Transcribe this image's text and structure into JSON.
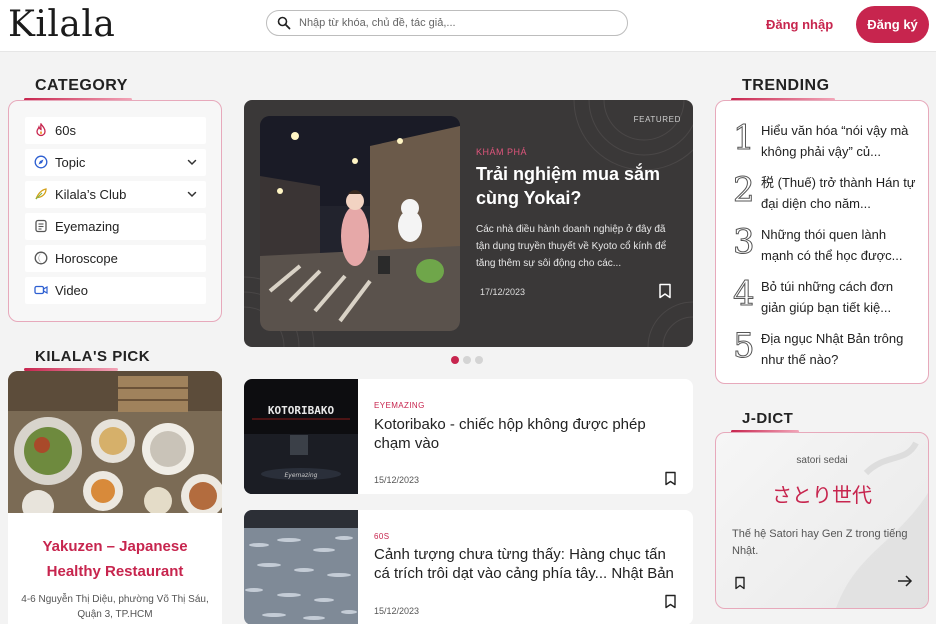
{
  "header": {
    "logo": "Kilala",
    "search_placeholder": "Nhập từ khóa, chủ đề, tác giả,...",
    "login_label": "Đăng nhập",
    "signup_label": "Đăng ký"
  },
  "category": {
    "title": "CATEGORY",
    "items": [
      {
        "label": "60s",
        "icon": "flame-icon",
        "has_chevron": false
      },
      {
        "label": "Topic",
        "icon": "compass-icon",
        "has_chevron": true
      },
      {
        "label": "Kilala’s Club",
        "icon": "feather-icon",
        "has_chevron": true
      },
      {
        "label": "Eyemazing",
        "icon": "note-icon",
        "has_chevron": false
      },
      {
        "label": "Horoscope",
        "icon": "moon-icon",
        "has_chevron": false
      },
      {
        "label": "Video",
        "icon": "video-icon",
        "has_chevron": false
      }
    ]
  },
  "pick": {
    "title": "KILALA'S PICK",
    "name": "Yakuzen – Japanese Healthy Restaurant",
    "address": "4-6 Nguyễn Thị Diệu, phường Võ Thị Sáu, Quận 3, TP.HCM"
  },
  "featured": {
    "tag": "FEATURED",
    "category": "KHÁM PHÁ",
    "title": "Trải nghiệm mua sắm cùng Yokai?",
    "description": "Các nhà điều hành doanh nghiệp ở đây đã tận dụng truyền thuyết về Kyoto cổ kính để tăng thêm sự sôi động cho các...",
    "date": "17/12/2023",
    "slides": 3,
    "active_slide": 1
  },
  "articles": [
    {
      "category": "EYEMAZING",
      "title": "Kotoribako - chiếc hộp không được phép chạm vào",
      "date": "15/12/2023",
      "image_text": "KOTORIBAKO"
    },
    {
      "category": "60S",
      "title": "Cảnh tượng chưa từng thấy: Hàng chục tấn cá trích trôi dạt vào cảng phía tây... Nhật Bản",
      "date": "15/12/2023"
    }
  ],
  "trending": {
    "title": "TRENDING",
    "items": [
      {
        "num": "1",
        "text": "Hiểu văn hóa “nói vậy mà không phải vậy” củ..."
      },
      {
        "num": "2",
        "text": "税 (Thuế) trở thành Hán tự đại diện cho năm..."
      },
      {
        "num": "3",
        "text": "Những thói quen lành mạnh có thể học được..."
      },
      {
        "num": "4",
        "text": "Bỏ túi những cách đơn giản giúp bạn tiết kiệ..."
      },
      {
        "num": "5",
        "text": "Địa ngục Nhật Bản trông như thế nào?"
      }
    ]
  },
  "jdict": {
    "title": "J-DICT",
    "romaji": "satori sedai",
    "word": "さとり世代",
    "description": "Thế hệ Satori hay Gen Z trong tiếng Nhật."
  },
  "colors": {
    "accent": "#c7254e",
    "featured_bg": "#3a3838",
    "page_bg": "#f3f3f3"
  }
}
